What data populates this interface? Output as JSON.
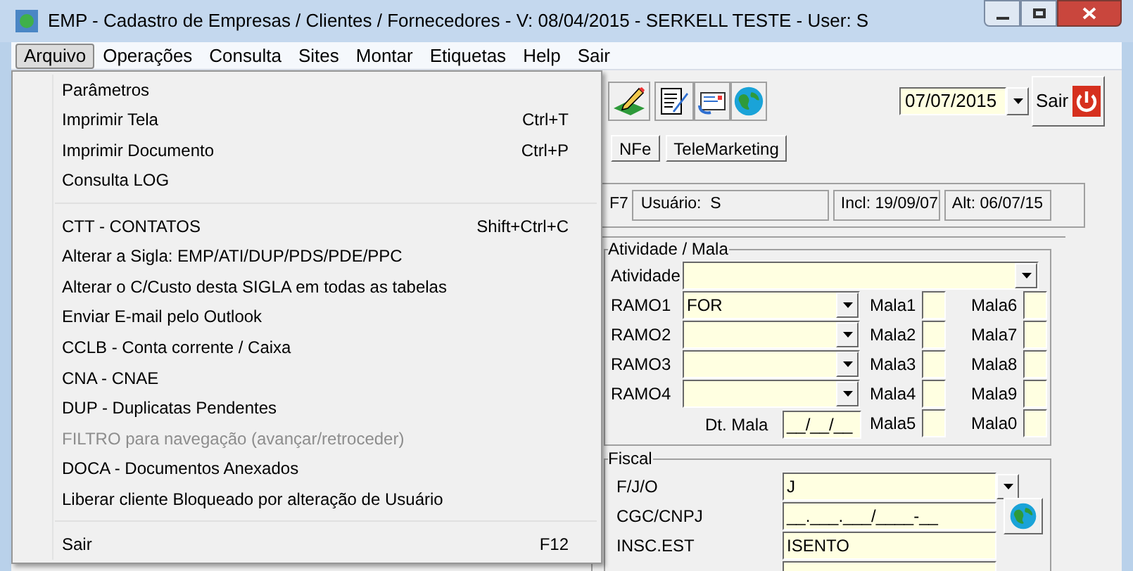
{
  "window": {
    "title": "EMP - Cadastro de Empresas / Clientes / Fornecedores - V: 08/04/2015 - SERKELL TESTE - User: S"
  },
  "menubar": [
    {
      "label": "Arquivo",
      "selected": true
    },
    {
      "label": "Operações",
      "selected": false
    },
    {
      "label": "Consulta",
      "selected": false
    },
    {
      "label": "Sites",
      "selected": false
    },
    {
      "label": "Montar",
      "selected": false
    },
    {
      "label": "Etiquetas",
      "selected": false
    },
    {
      "label": "Help",
      "selected": false
    },
    {
      "label": "Sair",
      "selected": false
    }
  ],
  "menu": {
    "items": [
      {
        "kind": "item",
        "label": "Parâmetros",
        "disabled": false
      },
      {
        "kind": "item",
        "label": "Imprimir Tela",
        "shortcut": "Ctrl+T",
        "disabled": false
      },
      {
        "kind": "item",
        "label": "Imprimir Documento",
        "shortcut": "Ctrl+P",
        "disabled": false
      },
      {
        "kind": "item",
        "label": "Consulta LOG",
        "disabled": false
      },
      {
        "kind": "separator"
      },
      {
        "kind": "item",
        "label": "CTT - CONTATOS",
        "shortcut": "Shift+Ctrl+C",
        "disabled": false
      },
      {
        "kind": "item",
        "label": "Alterar a Sigla: EMP/ATI/DUP/PDS/PDE/PPC",
        "disabled": false
      },
      {
        "kind": "item",
        "label": "Alterar o C/Custo desta SIGLA em todas as tabelas",
        "disabled": false
      },
      {
        "kind": "item",
        "label": "Enviar E-mail pelo Outlook",
        "disabled": false
      },
      {
        "kind": "item",
        "label": "CCLB - Conta corrente / Caixa",
        "disabled": false
      },
      {
        "kind": "item",
        "label": "CNA - CNAE",
        "disabled": false
      },
      {
        "kind": "item",
        "label": "DUP - Duplicatas Pendentes",
        "disabled": false
      },
      {
        "kind": "item",
        "label": "FILTRO para navegação (avançar/retroceder)",
        "disabled": true
      },
      {
        "kind": "item",
        "label": "DOCA - Documentos Anexados",
        "disabled": false
      },
      {
        "kind": "item",
        "label": "Liberar cliente Bloqueado por alteração de Usuário",
        "disabled": false
      },
      {
        "kind": "separator"
      },
      {
        "kind": "item",
        "label": "Sair",
        "shortcut": "F12",
        "disabled": false
      }
    ]
  },
  "toolbar": {
    "date": "07/07/2015",
    "exit_button": "Sair"
  },
  "tabs": [
    "NFe",
    "TeleMarketing"
  ],
  "info": {
    "key": "F7",
    "user": "Usuário:  S",
    "created": "Incl: 19/09/07",
    "changed": "Alt: 06/07/15"
  },
  "activity_group": {
    "title": "Atividade / Mala",
    "activity_label": "Atividade",
    "branches": [
      {
        "label": "RAMO1",
        "value": "FOR"
      },
      {
        "label": "RAMO2"
      },
      {
        "label": "RAMO3"
      },
      {
        "label": "RAMO4"
      }
    ],
    "date_label": "Dt. Mala",
    "date_value": "__/__/__",
    "mail_left": [
      "Mala1",
      "Mala2",
      "Mala3",
      "Mala4",
      "Mala5"
    ],
    "mail_right": [
      "Mala6",
      "Mala7",
      "Mala8",
      "Mala9",
      "Mala0"
    ]
  },
  "fiscal_group": {
    "title": "Fiscal",
    "fields": [
      {
        "kind": "combo",
        "label": "F/J/O",
        "value": "J"
      },
      {
        "kind": "lookup",
        "label": "CGC/CNPJ",
        "value": "__.___.___/____-__"
      },
      {
        "kind": "text",
        "label": "INSC.EST",
        "value": "ISENTO"
      }
    ]
  }
}
